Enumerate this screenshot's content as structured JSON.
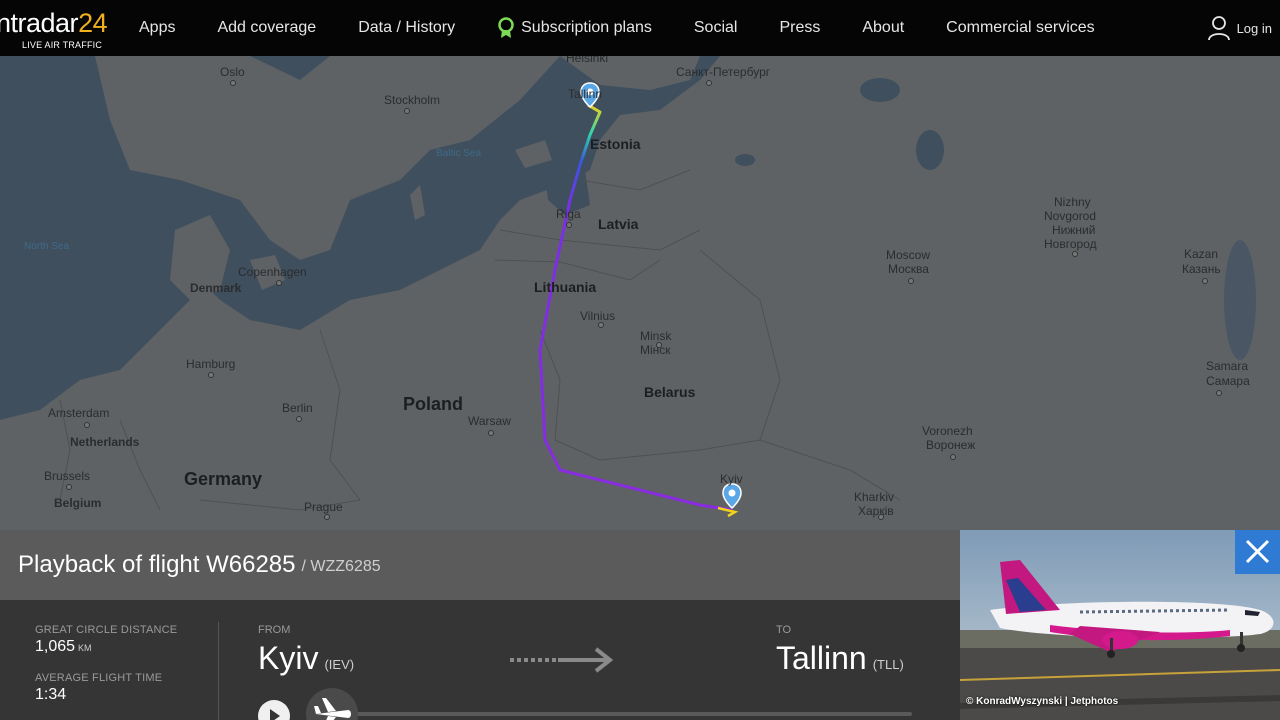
{
  "brand": {
    "logo_main": "ntradar",
    "logo_num": "24",
    "logo_sub": "LIVE AIR TRAFFIC"
  },
  "nav": {
    "items": [
      {
        "label": "Apps"
      },
      {
        "label": "Add coverage"
      },
      {
        "label": "Data / History"
      },
      {
        "label": "Subscription plans",
        "icon": "award-ribbon-icon"
      },
      {
        "label": "Social"
      },
      {
        "label": "Press"
      },
      {
        "label": "About"
      },
      {
        "label": "Commercial services"
      }
    ],
    "login_label": "Log in"
  },
  "map": {
    "labels": {
      "helsinki": "Helsinki",
      "stpetersburg": "Санкт-Петербург",
      "oslo": "Oslo",
      "stockholm": "Stockholm",
      "tallinn": "Tallinn",
      "estonia": "Estonia",
      "baltic_sea": "Baltic Sea",
      "riga": "Riga",
      "latvia": "Latvia",
      "north_sea": "North Sea",
      "copenhagen": "Copenhagen",
      "denmark": "Denmark",
      "lithuania": "Lithuania",
      "vilnius": "Vilnius",
      "minsk_en": "Minsk",
      "minsk_local": "Мінск",
      "belarus": "Belarus",
      "hamburg": "Hamburg",
      "amsterdam": "Amsterdam",
      "netherlands": "Netherlands",
      "berlin": "Berlin",
      "poland": "Poland",
      "warsaw": "Warsaw",
      "germany": "Germany",
      "brussels": "Brussels",
      "belgium": "Belgium",
      "prague": "Prague",
      "kyiv": "Kyiv",
      "kharkiv_en": "Kharkiv",
      "kharkiv_local": "Харків",
      "nizhny_en_1": "Nizhny",
      "nizhny_en_2": "Novgorod",
      "nizhny_local_1": "Нижний",
      "nizhny_local_2": "Новгород",
      "moscow_en": "Moscow",
      "moscow_local": "Москва",
      "kazan_en": "Kazan",
      "kazan_local": "Казань",
      "samara_en": "Samara",
      "samara_local": "Самара",
      "voronezh_en": "Voronezh",
      "voronezh_local": "Воронеж"
    },
    "colors": {
      "track_start": "#f2d21b",
      "track_mid": "#2fd5a8",
      "track_blue": "#3a56e0",
      "track_end": "#8a2be2",
      "marker": "#5aa7e8"
    }
  },
  "flight": {
    "title": "Playback of flight W66285",
    "callsign": "/ WZZ6285",
    "distance_label": "GREAT CIRCLE DISTANCE",
    "distance_value": "1,065",
    "distance_unit": "KM",
    "time_label": "AVERAGE FLIGHT TIME",
    "time_value": "1:34",
    "from_label": "FROM",
    "from_city": "Kyiv",
    "from_code": "(IEV)",
    "to_label": "TO",
    "to_city": "Tallinn",
    "to_code": "(TLL)",
    "progress": 0
  },
  "photo": {
    "credit": "© KonradWyszynski | Jetphotos"
  }
}
